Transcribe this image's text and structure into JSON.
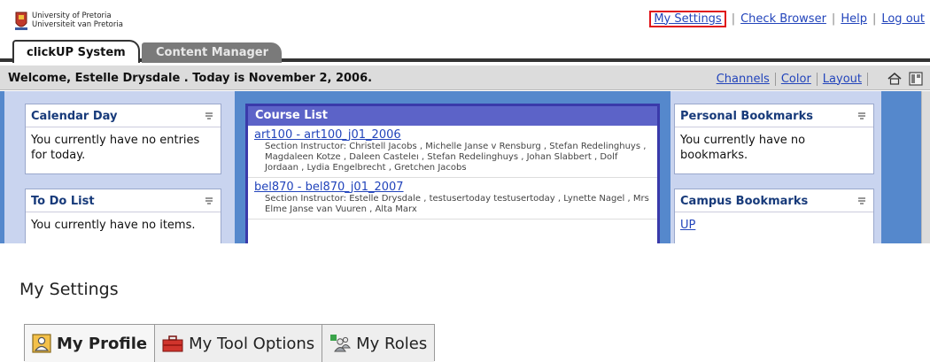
{
  "header": {
    "university_name_line1": "University of Pretoria",
    "university_name_line2": "Universiteit van Pretoria",
    "links": {
      "my_settings": "My Settings",
      "check_browser": "Check Browser",
      "help": "Help",
      "log_out": "Log out",
      "separator": "|"
    }
  },
  "tabs": {
    "primary": "clickUP System",
    "secondary": "Content Manager"
  },
  "welcome": {
    "message": "Welcome, Estelle Drysdale . Today is November 2, 2006.",
    "channels": "Channels",
    "color": "Color",
    "layout": "Layout",
    "icons": [
      "home-icon",
      "layout-grid-icon"
    ]
  },
  "left_channels": [
    {
      "title": "Calendar Day",
      "body": "You currently have no entries for today."
    },
    {
      "title": "To Do List",
      "body": "You currently have no items."
    }
  ],
  "course_list": {
    "title": "Course List",
    "courses": [
      {
        "link": "art100 - art100_j01_2006",
        "instructors": "Section Instructor: Christell Jacobs , Michelle Janse v Rensburg , Stefan Redelinghuys , Magdaleen Kotze , Daleen Casteleı , Stefan Redelinghuys , Johan Slabbert , Dolf Jordaan , Lydia Engelbrecht , Gretchen Jacobs"
      },
      {
        "link": "bel870 - bel870_j01_2007",
        "instructors": "Section Instructor: Estelle Drysdale , testusertoday testusertoday , Lynette Nagel , Mrs Elme Janse van Vuuren , Alta Marx"
      }
    ]
  },
  "right_channels": [
    {
      "title": "Personal Bookmarks",
      "body": "You currently have no bookmarks."
    },
    {
      "title": "Campus Bookmarks",
      "link": "UP"
    }
  ],
  "settings": {
    "title": "My Settings",
    "tabs": [
      {
        "label": "My Profile",
        "icon": "profile-icon",
        "active": true
      },
      {
        "label": "My Tool Options",
        "icon": "toolbox-icon",
        "active": false
      },
      {
        "label": "My Roles",
        "icon": "roles-icon",
        "active": false
      }
    ]
  },
  "colors": {
    "accent_link": "#2244bb",
    "highlight_box": "#e0141a",
    "channel_bg": "#5588cc",
    "course_header": "#5c63c8"
  }
}
